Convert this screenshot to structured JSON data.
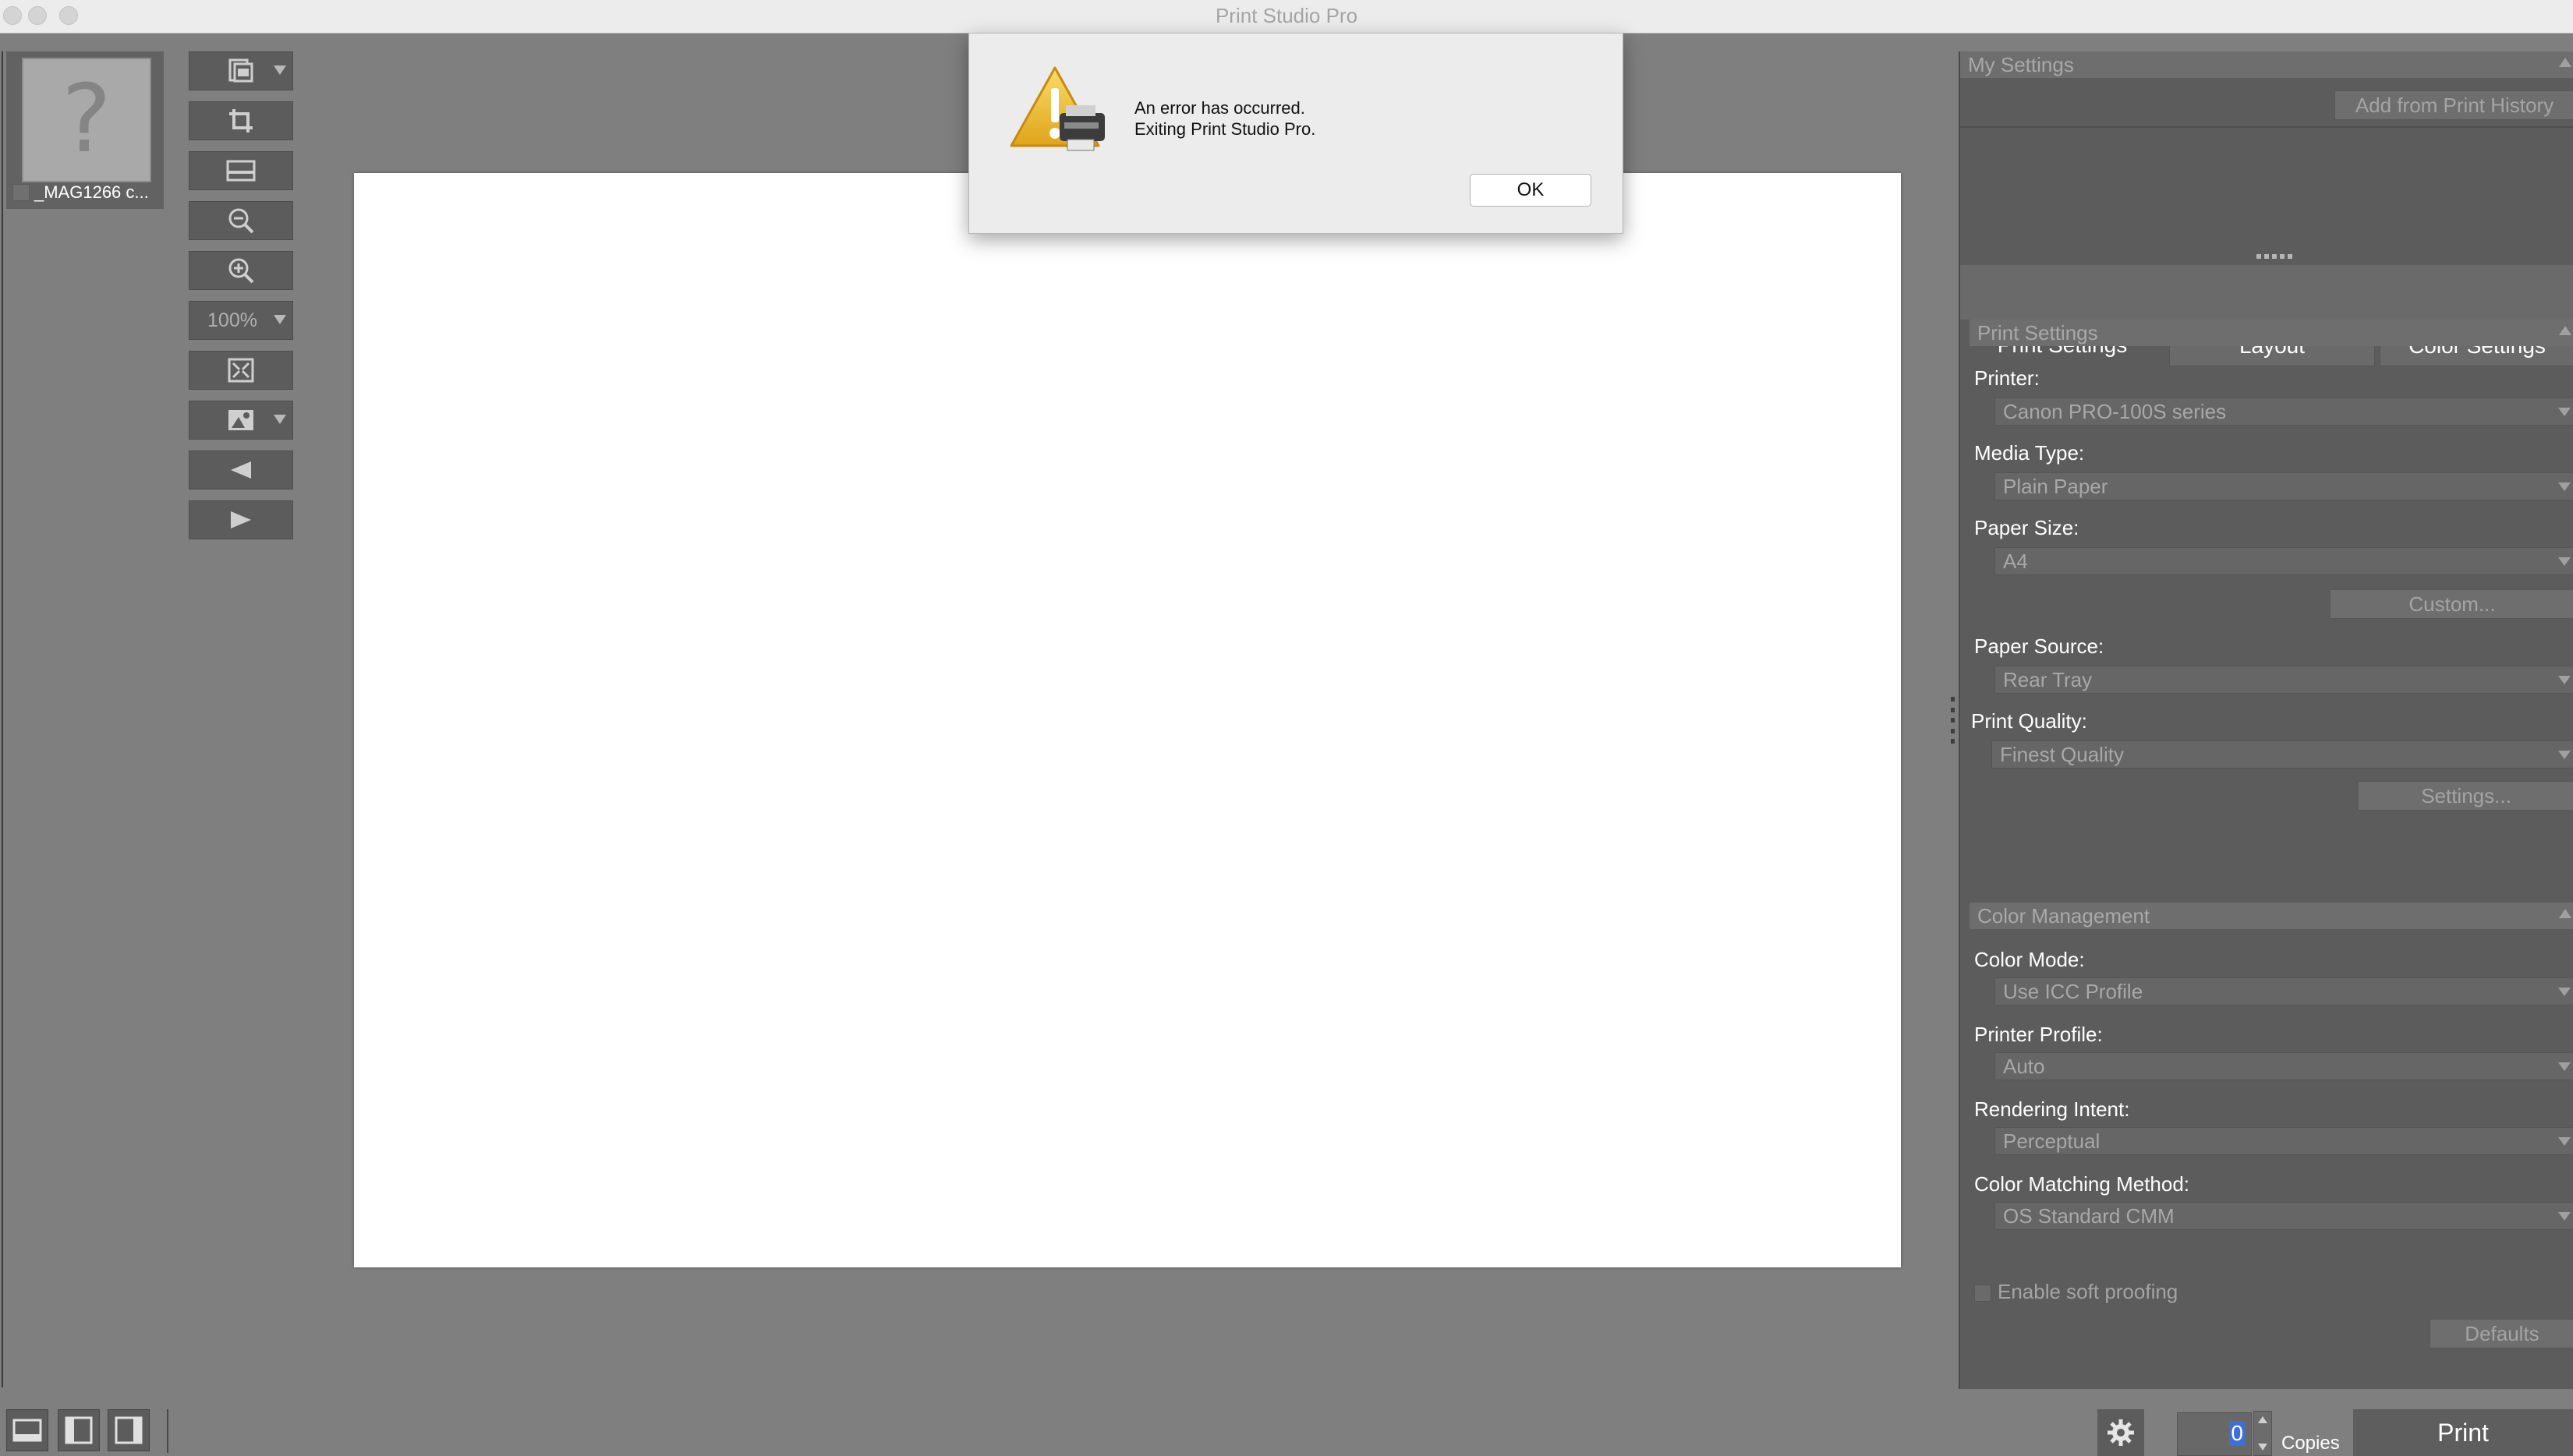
{
  "window": {
    "title": "Print Studio Pro"
  },
  "thumbnail": {
    "filename": "_MAG1266 c...",
    "placeholder_glyph": "?"
  },
  "toolbar": {
    "zoom_level": "100%",
    "icons": [
      "layout-icon",
      "crop-icon",
      "fit-page-icon",
      "zoom-out-icon",
      "zoom-in-icon",
      "zoom-level",
      "fullscreen-icon",
      "image-adjust-icon",
      "previous-icon",
      "next-icon"
    ]
  },
  "right_panel": {
    "my_settings": {
      "header": "My Settings",
      "add_from_history": "Add from Print History"
    },
    "tabs": [
      {
        "label": "Print Settings",
        "active": true
      },
      {
        "label": "Layout",
        "active": false
      },
      {
        "label": "Color Settings",
        "active": false
      }
    ],
    "print_settings": {
      "header": "Print Settings",
      "printer_label": "Printer:",
      "printer_value": "Canon PRO-100S series",
      "media_label": "Media Type:",
      "media_value": "Plain Paper",
      "size_label": "Paper Size:",
      "size_value": "A4",
      "custom_button": "Custom...",
      "source_label": "Paper Source:",
      "source_value": "Rear Tray",
      "quality_label": "Print Quality:",
      "quality_value": "Finest Quality",
      "settings_button": "Settings..."
    },
    "color_management": {
      "header": "Color Management",
      "mode_label": "Color Mode:",
      "mode_value": "Use ICC Profile",
      "profile_label": "Printer Profile:",
      "profile_value": "Auto",
      "intent_label": "Rendering Intent:",
      "intent_value": "Perceptual",
      "method_label": "Color Matching Method:",
      "method_value": "OS Standard CMM",
      "soft_proofing_label": "Enable soft proofing",
      "defaults_button": "Defaults"
    }
  },
  "bottom_bar": {
    "copies_value": "0",
    "copies_label": "Copies",
    "print_button": "Print"
  },
  "dialog": {
    "line1": "An error has occurred.",
    "line2": "Exiting Print Studio Pro.",
    "ok_button": "OK"
  },
  "colors": {
    "background": "#7f7f7f",
    "panel": "#5c5c5c",
    "dialog": "#ececec",
    "warning": "#f2c233"
  }
}
